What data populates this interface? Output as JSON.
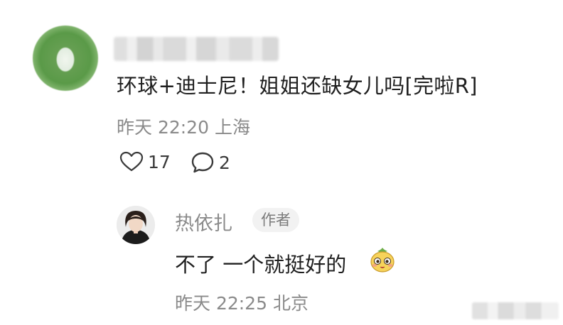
{
  "main_comment": {
    "username": "",
    "text": "环球+迪士尼！姐姐还缺女儿吗[完啦R]",
    "meta": "昨天 22:20 上海",
    "likes": "17",
    "replies": "2"
  },
  "reply": {
    "username": "热依扎",
    "badge": "作者",
    "text": "不了 一个就挺好的",
    "emoji_icon": "shy-face-emoji-icon",
    "meta": "昨天 22:25 北京"
  },
  "icons": {
    "like": "heart-outline-icon",
    "comment": "speech-bubble-icon"
  },
  "colors": {
    "primary_text": "#1f1f1f",
    "secondary_text": "#8a8a8a",
    "badge_bg": "#f2f2f2"
  }
}
